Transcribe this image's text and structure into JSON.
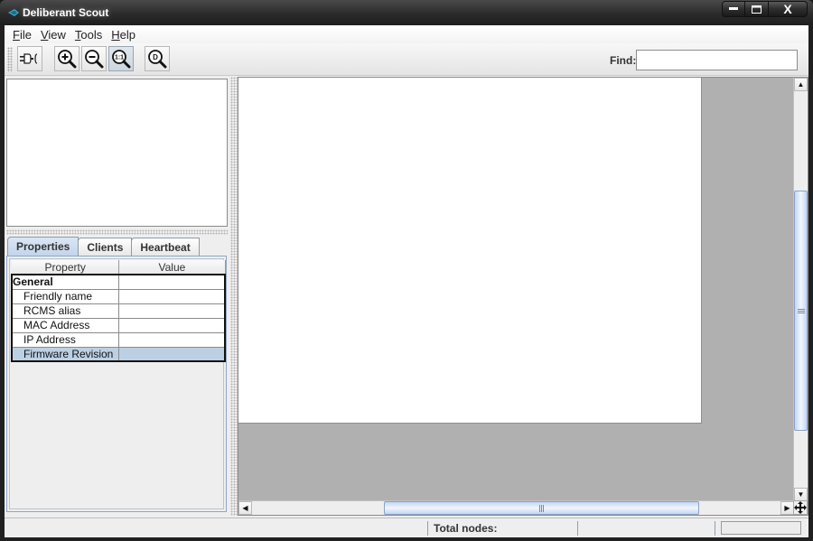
{
  "window": {
    "title": "Deliberant Scout",
    "icons": {
      "app": "app-logo-icon",
      "minimize": "minimize-icon",
      "maximize": "maximize-icon",
      "close": "close-icon"
    },
    "close_glyph": "X"
  },
  "menubar": {
    "items": [
      {
        "label_mnemonic": "F",
        "label_rest": "ile"
      },
      {
        "label_mnemonic": "V",
        "label_rest": "iew"
      },
      {
        "label_mnemonic": "T",
        "label_rest": "ools"
      },
      {
        "label_mnemonic": "H",
        "label_rest": "elp"
      }
    ]
  },
  "toolbar": {
    "buttons": [
      {
        "name": "connect-button",
        "icon": "plug-icon"
      },
      {
        "name": "zoom-in-button",
        "icon": "zoom-in-icon",
        "glyph": "+"
      },
      {
        "name": "zoom-out-button",
        "icon": "zoom-out-icon",
        "glyph": "−"
      },
      {
        "name": "zoom-actual-size-button",
        "icon": "zoom-actual-icon",
        "glyph": "1:1",
        "pressed": true
      },
      {
        "name": "zoom-fit-button",
        "icon": "zoom-fit-icon",
        "glyph": "D"
      }
    ],
    "find_label": "Find:",
    "find_value": "",
    "find_placeholder": ""
  },
  "left_panel": {
    "tabs": [
      {
        "label": "Properties",
        "active": true
      },
      {
        "label": "Clients",
        "active": false
      },
      {
        "label": "Heartbeat",
        "active": false
      }
    ],
    "properties_table": {
      "columns": [
        "Property",
        "Value"
      ],
      "rows": [
        {
          "property": "General",
          "value": "",
          "group": true
        },
        {
          "property": "Friendly name",
          "value": ""
        },
        {
          "property": "RCMS alias",
          "value": ""
        },
        {
          "property": "MAC Address",
          "value": ""
        },
        {
          "property": "IP Address",
          "value": ""
        },
        {
          "property": "Firmware Revision",
          "value": "",
          "selected": true
        }
      ]
    }
  },
  "canvas": {
    "scroll_arrows": {
      "up": "▲",
      "down": "▼",
      "left": "◀",
      "right": "▶"
    },
    "grip": "|||",
    "corner_icon": "move-icon"
  },
  "statusbar": {
    "left_text": "",
    "total_nodes_label": "Total nodes:",
    "total_nodes_value": ""
  },
  "colors": {
    "selection": "#bcd0e4",
    "canvas_background": "#b0b0b0",
    "tab_active": "#c3d5ec"
  }
}
